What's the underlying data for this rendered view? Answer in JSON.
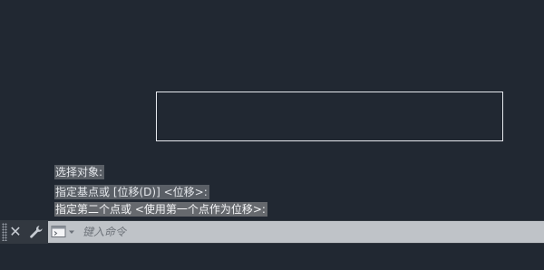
{
  "command_history": [
    "选择对象:",
    "指定基点或 [位移(D)] <位移>:",
    "指定第二个点或 <使用第一个点作为位移>:"
  ],
  "command_line": {
    "placeholder": "键入命令",
    "value": "",
    "close_icon": "close-icon",
    "customize_icon": "wrench-icon",
    "recent_commands_icon": "command-prompt-icon"
  },
  "colors": {
    "canvas_background": "#212832",
    "history_highlight": "#5a5f66",
    "input_background": "#bfc3c8",
    "rectangle_stroke": "#e6e9ee"
  }
}
